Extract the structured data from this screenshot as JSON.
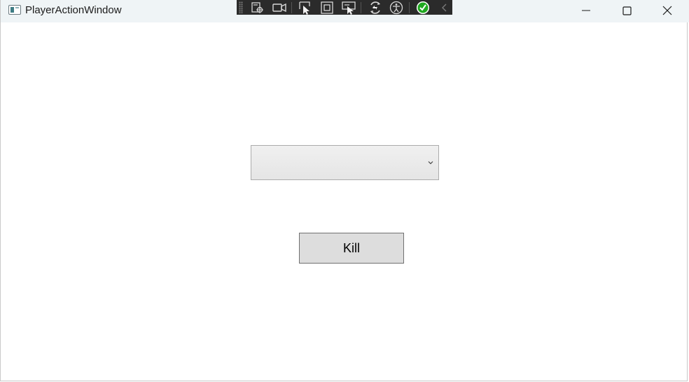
{
  "window": {
    "title": "PlayerActionWindow",
    "icon": "window-app-icon",
    "caption_buttons": [
      "minimize-icon",
      "maximize-icon",
      "close-icon"
    ]
  },
  "debug_toolbar": {
    "tools": [
      "live-visual-tree-icon",
      "track-focused-element-icon",
      "select-element-icon",
      "display-layout-adorners-icon",
      "preview-selection-icon",
      "hot-reload-icon",
      "accessibility-checker-icon",
      "binding-check-icon",
      "collapse-toolbar-icon"
    ]
  },
  "main": {
    "action_combo": {
      "selected_value": ""
    },
    "kill_button": {
      "label": "Kill"
    }
  },
  "colors": {
    "titlebar_bg": "#eff4f6",
    "toolbar_bg": "#2b2b2b",
    "button_bg": "#dddddd",
    "button_border": "#707070",
    "check_green": "#20a820"
  }
}
